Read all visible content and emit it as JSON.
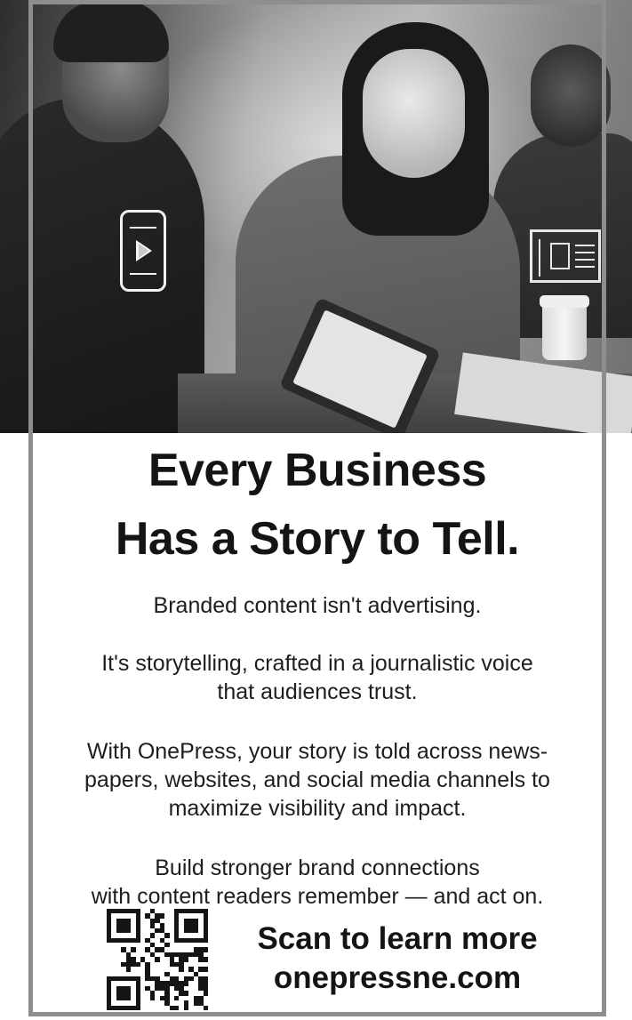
{
  "hero": {
    "icons": [
      "play-phone-icon",
      "newspaper-icon"
    ]
  },
  "headline": {
    "line1": "Every Business",
    "line2": "Has a Story to Tell."
  },
  "body": {
    "p1": "Branded content isn't advertising.",
    "p2_line1": "It's storytelling, crafted in a journalistic voice",
    "p2_line2": "that audiences trust.",
    "p3_line1": "With OnePress, your story is told across news-",
    "p3_line2": "papers, websites, and social media channels to",
    "p3_line3": "maximize visibility and impact.",
    "p4_line1": "Build stronger brand connections",
    "p4_line2": "with content readers remember — and act on."
  },
  "cta": {
    "line1": "Scan to learn more",
    "line2": "onepressne.com",
    "qr_icon": "qr-code-icon"
  },
  "colors": {
    "border": "#8e8e8e",
    "text": "#141414"
  }
}
